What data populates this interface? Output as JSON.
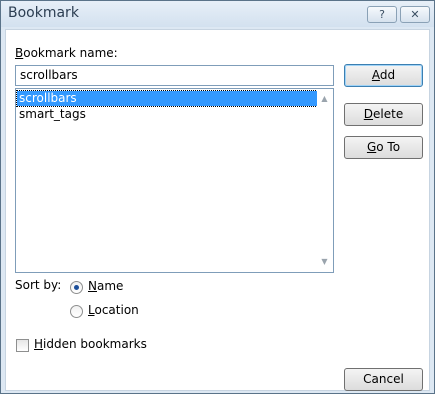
{
  "window": {
    "title": "Bookmark",
    "help_button": "?",
    "close_button": "✕"
  },
  "bookmark_name": {
    "label_accel": "B",
    "label_rest": "ookmark name:",
    "value": "scrollbars"
  },
  "bookmark_list": {
    "items": [
      "scrollbars",
      "smart_tags"
    ],
    "selected": "scrollbars"
  },
  "buttons": {
    "add_accel": "A",
    "add_rest": "dd",
    "delete_accel": "D",
    "delete_rest": "elete",
    "goto_accel": "G",
    "goto_rest": "o To",
    "cancel": "Cancel"
  },
  "sort": {
    "label": "Sort by:",
    "name_accel": "N",
    "name_rest": "ame",
    "location_accel": "L",
    "location_rest": "ocation",
    "selected": "Name"
  },
  "hidden": {
    "accel": "H",
    "rest": "idden bookmarks",
    "checked": false
  },
  "colors": {
    "selection": "#3399ff",
    "window_border": "#5a7389"
  }
}
